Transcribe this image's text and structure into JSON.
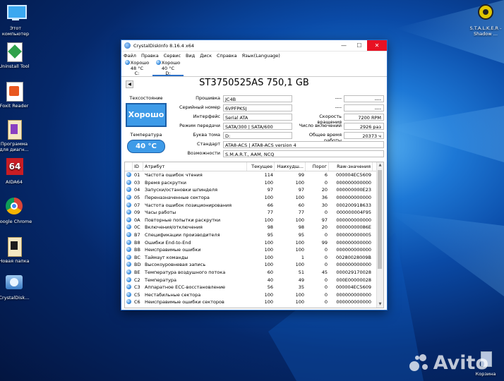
{
  "desktop": {
    "icons": [
      {
        "name": "this-pc",
        "label": "Этот компьютер"
      },
      {
        "name": "uninstall-tool",
        "label": "Uninstall Tool"
      },
      {
        "name": "foxit-reader",
        "label": "Foxit Reader"
      },
      {
        "name": "diag-programs",
        "label": "Программа для диагн..."
      },
      {
        "name": "aida64",
        "label": "AIDA64"
      },
      {
        "name": "google-chrome",
        "label": "Google Chrome"
      },
      {
        "name": "new-folder",
        "label": "Новая папка"
      },
      {
        "name": "crystaldisk",
        "label": "CrystalDisk..."
      },
      {
        "name": "stalker",
        "label": "S.T.A.L.K.E.R - Shadow ..."
      },
      {
        "name": "recycle-bin",
        "label": "Корзина"
      }
    ],
    "watermark": "Avito"
  },
  "window": {
    "title": "CrystalDiskInfo 8.16.4 x64",
    "minimize": "—",
    "maximize": "☐",
    "close": "✕",
    "menu": [
      "Файл",
      "Правка",
      "Сервис",
      "Вид",
      "Диск",
      "Справка",
      "Язык(Language)"
    ],
    "disks": [
      {
        "status": "Хорошо",
        "temp": "48 °C",
        "letter": "C:"
      },
      {
        "status": "Хорошо",
        "temp": "40 °C",
        "letter": "D:"
      }
    ],
    "disk_title": "ST3750525AS 750,1 GB",
    "tech_state_label": "Техсостояние",
    "health": "Хорошо",
    "temp_label": "Температура",
    "temperature": "40 °C",
    "info": {
      "firmware_label": "Прошивка",
      "firmware": "JC4B",
      "serial_label": "Серийный номер",
      "serial": "6VPFPKSJ",
      "interface_label": "Интерфейс",
      "interface": "Serial ATA",
      "mode_label": "Режим передачи",
      "mode": "SATA/300 | SATA/600",
      "volume_label": "Буква тома",
      "volume": "D:",
      "standard_label": "Стандарт",
      "standard": "ATA8-ACS | ATA8-ACS version 4",
      "features_label": "Возможности",
      "features": "S.M.A.R.T., AAM, NCQ",
      "r1_label": "----",
      "r1": "----",
      "r2_label": "----",
      "r2": "----",
      "rpm_label": "Скорость вращения",
      "rpm": "7200 RPM",
      "power_count_label": "Число включений",
      "power_count": "2926 раз",
      "hours_label": "Общее время работы",
      "hours": "20373 ч"
    },
    "table": {
      "headers": [
        "ID",
        "Атрибут",
        "Текущее",
        "Наихудш...",
        "Порог",
        "Raw-значения"
      ],
      "rows": [
        [
          "01",
          "Частота ошибок чтения",
          "114",
          "99",
          "6",
          "000004EC5609"
        ],
        [
          "03",
          "Время раскрутки",
          "100",
          "100",
          "0",
          "000000000000"
        ],
        [
          "04",
          "Запуски/остановки шпинделя",
          "97",
          "97",
          "20",
          "000000000E23"
        ],
        [
          "05",
          "Переназначенные сектора",
          "100",
          "100",
          "36",
          "000000000000"
        ],
        [
          "07",
          "Частота ошибок позиционирования",
          "66",
          "60",
          "30",
          "000200918633"
        ],
        [
          "09",
          "Часы работы",
          "77",
          "77",
          "0",
          "000000004F95"
        ],
        [
          "0A",
          "Повторные попытки раскрутки",
          "100",
          "100",
          "97",
          "000000000000"
        ],
        [
          "0C",
          "Включения/отключения",
          "98",
          "98",
          "20",
          "00000000086E"
        ],
        [
          "B7",
          "Спецификации производителя",
          "95",
          "95",
          "0",
          "000000000005"
        ],
        [
          "B8",
          "Ошибки End-to-End",
          "100",
          "100",
          "99",
          "000000000000"
        ],
        [
          "BB",
          "Неисправимые ошибки",
          "100",
          "100",
          "0",
          "000000000000"
        ],
        [
          "BC",
          "Таймаут команды",
          "100",
          "1",
          "0",
          "00280028009B"
        ],
        [
          "BD",
          "Высокоуровневая запись",
          "100",
          "100",
          "0",
          "000000000000"
        ],
        [
          "BE",
          "Температура воздушного потока",
          "60",
          "51",
          "45",
          "000029170028"
        ],
        [
          "C2",
          "Температура",
          "40",
          "49",
          "0",
          "000E00000028"
        ],
        [
          "C3",
          "Аппаратное ECC-восстановление",
          "56",
          "35",
          "0",
          "000004EC5609"
        ],
        [
          "C5",
          "Нестабильные сектора",
          "100",
          "100",
          "0",
          "000000000000"
        ],
        [
          "C6",
          "Неисправимые ошибки секторов",
          "100",
          "100",
          "0",
          "000000000000"
        ]
      ]
    }
  }
}
